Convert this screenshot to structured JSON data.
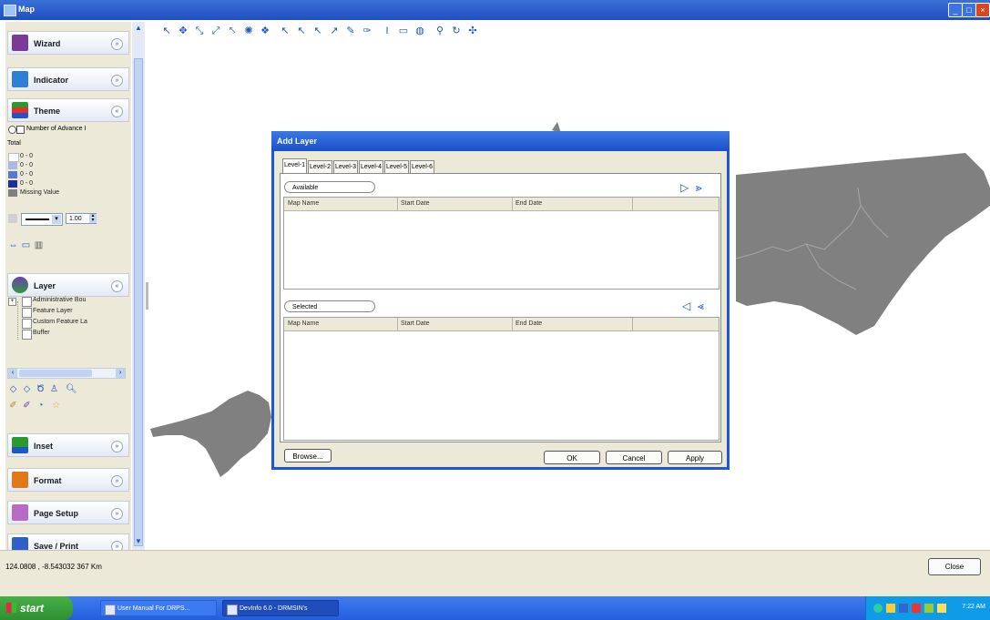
{
  "window": {
    "title": "Map",
    "controls": [
      "_",
      "□",
      "×"
    ]
  },
  "sidebar": {
    "panels": {
      "wizard": {
        "label": "Wizard",
        "icon": "wizard-icon",
        "toggle": "»"
      },
      "indicator": {
        "label": "Indicator",
        "icon": "indicator-icon",
        "toggle": "»"
      },
      "theme": {
        "label": "Theme",
        "icon": "theme-icon",
        "toggle": "«"
      },
      "layer": {
        "label": "Layer",
        "icon": "layer-icon",
        "toggle": "«"
      },
      "inset": {
        "label": "Inset",
        "icon": "inset-icon",
        "toggle": "»"
      },
      "format": {
        "label": "Format",
        "icon": "format-icon",
        "toggle": "»"
      },
      "page_setup": {
        "label": "Page Setup",
        "icon": "page-setup-icon",
        "toggle": "»"
      },
      "save_print": {
        "label": "Save / Print",
        "icon": "save-icon",
        "toggle": "»"
      }
    },
    "theme": {
      "indicator_name": "Number of Advance I",
      "total_label": "Total",
      "legend": [
        {
          "label": "0 - 0",
          "color": "#ffffff"
        },
        {
          "label": "0 - 0",
          "color": "#a9b9e6"
        },
        {
          "label": "0 - 0",
          "color": "#5a78d2"
        },
        {
          "label": "0 - 0",
          "color": "#1d2f9e"
        }
      ],
      "missing_label": "Missing Value",
      "missing_color": "#808080",
      "line_width": "1.00"
    },
    "layer": {
      "items": [
        "Administrative Bou",
        "Feature Layer",
        "Custom Feature La",
        "Buffer"
      ]
    }
  },
  "toolbar": {
    "tools": [
      "select-arrow",
      "pan",
      "zoom-in",
      "zoom-out",
      "zoom-previous",
      "full-extent",
      "zoom-extent",
      "identify",
      "info",
      "pointer",
      "draw-line",
      "measure",
      "label",
      "text",
      "rectangle",
      "ellipse",
      "link",
      "refresh",
      "settings"
    ]
  },
  "status": {
    "coordinates": "124.0808 , -8.543032  367 Km"
  },
  "close_button": "Close",
  "taskbar": {
    "start": "start",
    "items": [
      "User Manual For DRPS...",
      "DevInfo 6.0 - DRMSIN's"
    ],
    "clock": "7:22 AM"
  },
  "dialog": {
    "title": "Add Layer",
    "tabs": [
      "Level-1",
      "Level-2",
      "Level-3",
      "Level-4",
      "Level-5",
      "Level-6"
    ],
    "available_label": "Available",
    "selected_label": "Selected",
    "columns": [
      "Map Name",
      "Start Date",
      "End Date"
    ],
    "buttons": {
      "browse": "Browse...",
      "ok": "OK",
      "cancel": "Cancel",
      "apply": "Apply"
    }
  },
  "colors": {
    "map_fill": "#808080",
    "accent": "#1f55d8"
  }
}
